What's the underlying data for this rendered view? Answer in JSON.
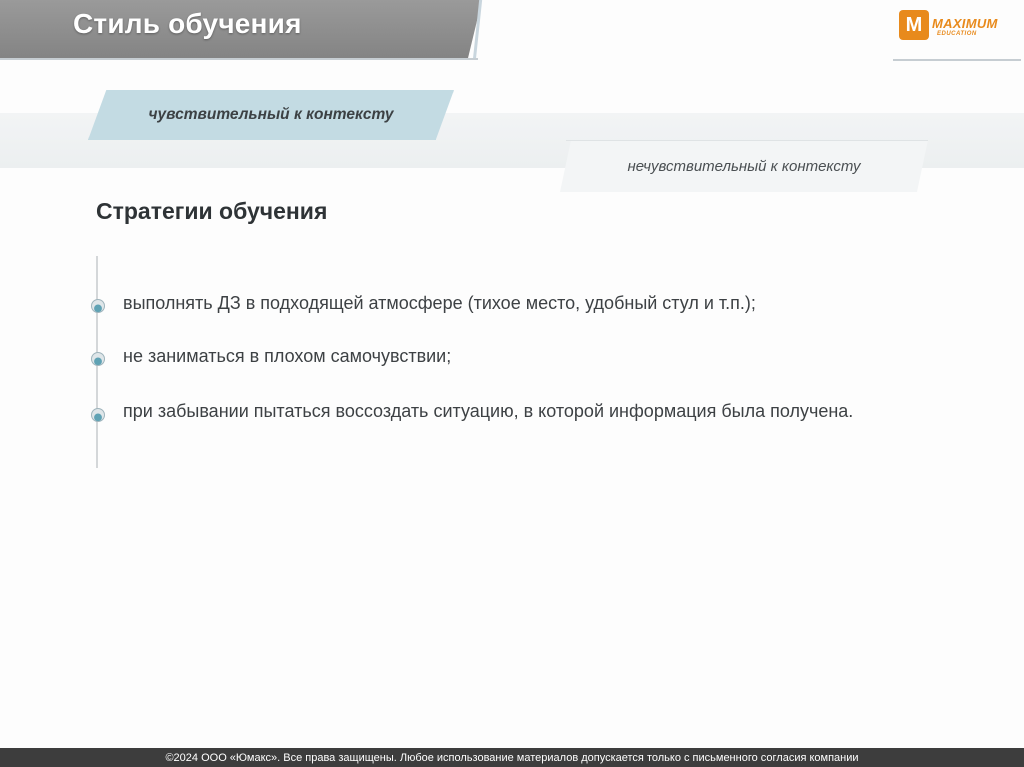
{
  "header": {
    "title": "Стиль обучения"
  },
  "logo": {
    "name": "MAXIMUM",
    "sub": "EDUCATION"
  },
  "tags": {
    "context_sensitive": "чувствительный к контексту",
    "context_insensitive": "нечувствительный к контексту"
  },
  "section": {
    "title": "Стратегии обучения"
  },
  "items": [
    "выполнять ДЗ в подходящей атмосфере (тихое место, удобный стул и т.п.);",
    "не заниматься в плохом самочувствии;",
    "при забывании пытаться воссоздать ситуацию, в которой информация была получена."
  ],
  "footer": {
    "text": "©2024 ООО «Юмакс». Все права защищены. Любое использование материалов допускается только с письменного согласия компании"
  },
  "colors": {
    "header": "#8c8c8c",
    "accent_tag": "#c3dbe3",
    "logo": "#e88a1c",
    "footer": "#3d3d3d"
  }
}
